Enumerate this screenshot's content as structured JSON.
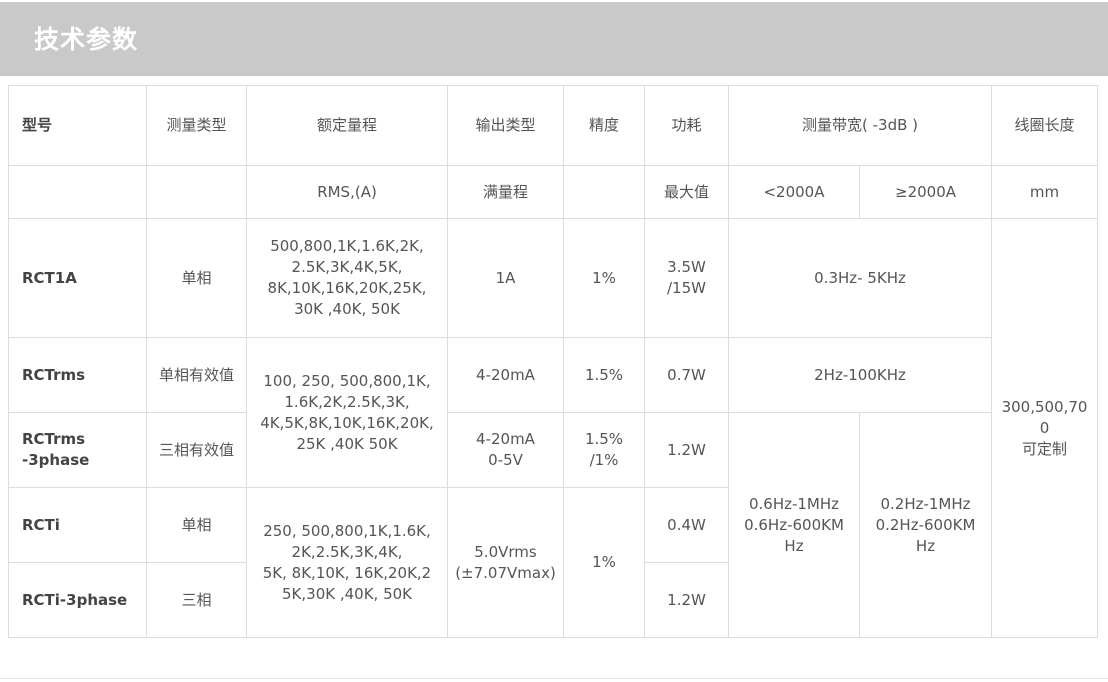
{
  "page": {
    "title": "技术参数"
  },
  "table": {
    "header": {
      "model": "型号",
      "measure_type": "测量类型",
      "rated_range": "额定量程",
      "output_type": "输出类型",
      "accuracy": "精度",
      "power": "功耗",
      "bandwidth": "测量带宽( -3dB )",
      "coil_length": "线圈长度"
    },
    "subheader": {
      "model": "",
      "measure_type": "",
      "rated_range": "RMS,(A)",
      "output_type": "满量程",
      "accuracy": "",
      "power": "最大值",
      "bw_low": "<2000A",
      "bw_high": "≥2000A",
      "coil_length": "mm"
    },
    "rows": [
      {
        "model": "RCT1A",
        "measure_type": "单相",
        "rated_range": [
          "500,800,1K,1.6K,2K,",
          "2.5K,3K,4K,5K,",
          "8K,10K,16K,20K,25K,",
          "30K ,40K, 50K"
        ],
        "output_type": [
          "1A"
        ],
        "accuracy": [
          "1%"
        ],
        "power": [
          "3.5W",
          "/15W"
        ],
        "bandwidth": "0.3Hz- 5KHz"
      },
      {
        "model": "RCTrms",
        "measure_type": "单相有效值",
        "output_type": [
          "4-20mA"
        ],
        "accuracy": [
          "1.5%"
        ],
        "power": [
          "0.7W"
        ],
        "bandwidth": "2Hz-100KHz"
      },
      {
        "model": [
          "RCTrms",
          "-3phase"
        ],
        "measure_type": "三相有效值",
        "output_type": [
          "4-20mA",
          "0-5V"
        ],
        "accuracy": [
          "1.5%",
          "/1%"
        ],
        "power": [
          "1.2W"
        ]
      },
      {
        "model": "RCTi",
        "measure_type": "单相",
        "power": [
          "0.4W"
        ]
      },
      {
        "model": "RCTi-3phase",
        "measure_type": "三相",
        "power": [
          "1.2W"
        ]
      }
    ],
    "merged": {
      "range_rms": [
        "100, 250, 500,800,1K,",
        "1.6K,2K,2.5K,3K,",
        "4K,5K,8K,10K,16K,20K,",
        "25K ,40K 50K"
      ],
      "range_i": [
        "250, 500,800,1K,1.6K,",
        "2K,2.5K,3K,4K,",
        "5K, 8K,10K, 16K,20K,2",
        "5K,30K ,40K, 50K"
      ],
      "output_i": [
        "5.0Vrms",
        "(±7.07Vmax)"
      ],
      "accuracy_i": [
        "1%"
      ],
      "bw_low_3phase": [
        "0.6Hz-1MHz",
        "0.6Hz-600KM",
        "Hz"
      ],
      "bw_high_3phase": [
        "0.2Hz-1MHz",
        "0.2Hz-600KM",
        "Hz"
      ],
      "coil_length": [
        "300,500,70",
        "0",
        "可定制"
      ]
    }
  }
}
